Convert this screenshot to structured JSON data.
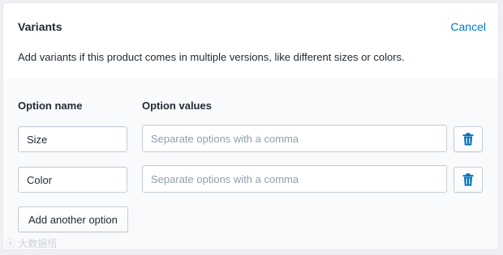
{
  "header": {
    "title": "Variants",
    "cancel_label": "Cancel",
    "description": "Add variants if this product comes in multiple versions, like different sizes or colors."
  },
  "columns": {
    "name_label": "Option name",
    "values_label": "Option values"
  },
  "options": [
    {
      "name": "Size",
      "values": "",
      "values_placeholder": "Separate options with a comma"
    },
    {
      "name": "Color",
      "values": "",
      "values_placeholder": "Separate options with a comma"
    }
  ],
  "add_option_label": "Add another option",
  "icons": {
    "delete": "trash-icon"
  },
  "watermark": "ⓔ 大数据悟",
  "colors": {
    "accent": "#007ace",
    "text": "#212b36",
    "body_bg": "#f9fafb",
    "border": "#c4cdd5"
  }
}
